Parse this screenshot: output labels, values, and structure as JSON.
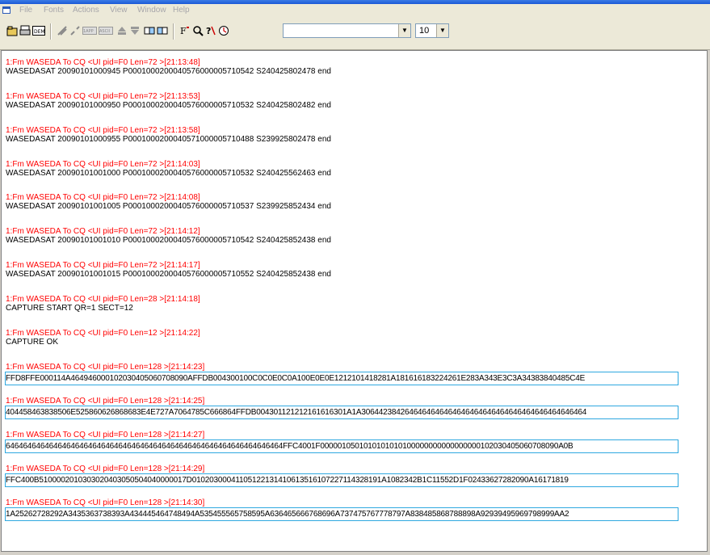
{
  "menu": [
    "File",
    "Fonts",
    "Actions",
    "View",
    "Window",
    "Help"
  ],
  "toolbar": {
    "combo_text": "",
    "font_size": "10"
  },
  "log": [
    {
      "hdr": "1:Fm WASEDA To CQ <UI pid=F0 Len=72 >[21:13:48]",
      "body": "WASEDASAT 20090101000945 P00010002000405760000057105​42 S240425802478 end"
    },
    {
      "hdr": "1:Fm WASEDA To CQ <UI pid=F0 Len=72 >[21:13:53]",
      "body": "WASEDASAT 20090101000950 P0001000200040576000005710532 S240425802482 end"
    },
    {
      "hdr": "1:Fm WASEDA To CQ <UI pid=F0 Len=72 >[21:13:58]",
      "body": "WASEDASAT 20090101000955 P0001000200040571000005710488 S239925802478 end"
    },
    {
      "hdr": "1:Fm WASEDA To CQ <UI pid=F0 Len=72 >[21:14:03]",
      "body": "WASEDASAT 20090101001000 P0001000200040576000005710532 S240425562463 end"
    },
    {
      "hdr": "1:Fm WASEDA To CQ <UI pid=F0 Len=72 >[21:14:08]",
      "body": "WASEDASAT 20090101001005 P0001000200040576000005710537 S239925852434 end"
    },
    {
      "hdr": "1:Fm WASEDA To CQ <UI pid=F0 Len=72 >[21:14:12]",
      "body": "WASEDASAT 20090101001010 P0001000200040576000005710542 S240425852438 end"
    },
    {
      "hdr": "1:Fm WASEDA To CQ <UI pid=F0 Len=72 >[21:14:17]",
      "body": "WASEDASAT 20090101001015 P0001000200040576000005710552 S240425852438 end"
    },
    {
      "hdr": "1:Fm WASEDA To CQ <UI pid=F0 Len=28 >[21:14:18]",
      "body": "CAPTURE START QR=1 SECT=12"
    },
    {
      "hdr": "1:Fm WASEDA To CQ <UI pid=F0 Len=12 >[21:14:22]",
      "body": "CAPTURE OK"
    }
  ],
  "hexlog": [
    {
      "hdr": "1:Fm WASEDA To CQ <UI pid=F0 Len=128 >[21:14:23]",
      "body": "FFD8FFE000114A46494600010203040506070809​0AFFDB004300100C0C0E0C0A100E0E0E1212101418281A181616183224261E283A343E3C3A34383840485C4E"
    },
    {
      "hdr": "1:Fm WASEDA To CQ <UI pid=F0 Len=128 >[21:14:25]",
      "body": "404458463838506E525860626868683E4E727A7064785C666864FFDB00430112121216161630​1A1A3064423842646464646464646464646464646464646464646464"
    },
    {
      "hdr": "1:Fm WASEDA To CQ <UI pid=F0 Len=128 >[21:14:27]",
      "body": "6464646464646464646464646464646464646464646464646464646464646464FFC4001F0000010501010101010100000000000000000102030405060708090A0B"
    },
    {
      "hdr": "1:Fm WASEDA To CQ <UI pid=F0 Len=128 >[21:14:29]",
      "body": "FFC400B5100002010303020403050504040000017D01020300041105122131410613516107227114328191A1082342B1C11552D1F02433627282090A16171819"
    },
    {
      "hdr": "1:Fm WASEDA To CQ <UI pid=F0 Len=128 >[21:14:30]",
      "body": "1A25262728292A3435363738393A434445464748494A535455565758595A636465666768696A737475767778797A838485868788898A92939495969798999AA2"
    }
  ],
  "colors": {
    "header_text": "#ff0000",
    "hex_box_border": "#2fa8e0",
    "titlebar": "#1a58d6"
  }
}
